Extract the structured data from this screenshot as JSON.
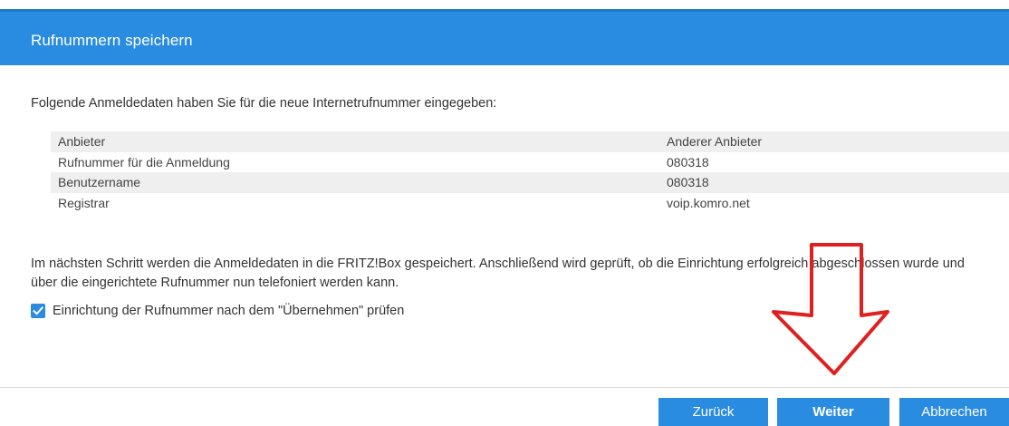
{
  "dialog": {
    "title": "Rufnummern speichern"
  },
  "intro_text": "Folgende Anmeldedaten haben Sie für die neue Internetrufnummer eingegeben:",
  "table": {
    "rows": [
      {
        "label": "Anbieter",
        "value": "Anderer Anbieter"
      },
      {
        "label": "Rufnummer für die Anmeldung",
        "value": "080318"
      },
      {
        "label": "Benutzername",
        "value": "080318"
      },
      {
        "label": "Registrar",
        "value": "voip.komro.net"
      }
    ]
  },
  "info_text": "Im nächsten Schritt werden die Anmeldedaten in die FRITZ!Box gespeichert. Anschließend wird geprüft, ob die Einrichtung erfolgreich abgeschlossen wurde und über die eingerichtete Rufnummer nun telefoniert werden kann.",
  "checkbox": {
    "label": "Einrichtung der Rufnummer nach dem \"Übernehmen\" prüfen",
    "checked": true,
    "icon": "checkmark-icon"
  },
  "buttons": {
    "back": "Zurück",
    "next": "Weiter",
    "cancel": "Abbrechen"
  },
  "annotation": {
    "icon": "down-arrow-annotation",
    "color": "#e02020"
  },
  "colors": {
    "header": "#2a8ce0",
    "button": "#2a8ce0",
    "row_alt": "#efefef"
  }
}
